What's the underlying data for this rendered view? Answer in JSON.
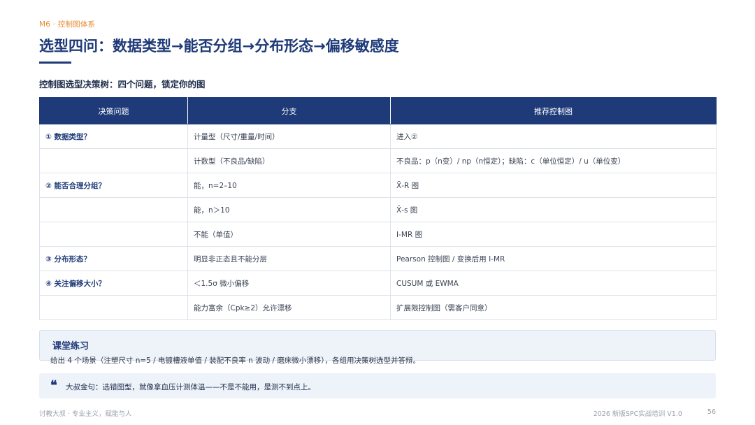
{
  "header": {
    "kicker": "M6 · 控制图体系",
    "title": "选型四问：数据类型→能否分组→分布形态→偏移敏感度",
    "subtitle": "控制图选型决策树：四个问题，锁定你的图"
  },
  "table": {
    "headers": [
      "决策问题",
      "分支",
      "推荐控制图"
    ],
    "rows": [
      {
        "question": "① 数据类型？",
        "branch": "计量型（尺寸/重量/时间）",
        "chart": "进入②"
      },
      {
        "question": "",
        "branch": "计数型（不良品/缺陷）",
        "chart": "不良品：p（n变）/ np（n恒定）；缺陷：c（单位恒定）/ u（单位变）"
      },
      {
        "question": "② 能否合理分组？",
        "branch": "能，n=2–10",
        "chart": "X̄-R 图"
      },
      {
        "question": "",
        "branch": "能，n＞10",
        "chart": "X̄-s 图"
      },
      {
        "question": "",
        "branch": "不能（单值）",
        "chart": "I-MR 图"
      },
      {
        "question": "③ 分布形态？",
        "branch": "明显非正态且不能分层",
        "chart": "Pearson 控制图 / 变换后用 I-MR"
      },
      {
        "question": "④ 关注偏移大小？",
        "branch": "＜1.5σ 微小偏移",
        "chart": "CUSUM 或 EWMA"
      },
      {
        "question": "",
        "branch": "能力富余（Cpk≥2）允许漂移",
        "chart": "扩展限控制图（需客户同意）"
      }
    ]
  },
  "exercise": {
    "title": "课堂练习",
    "body": "给出 4 个场景（注塑尺寸 n=5 / 电镀槽液单值 / 装配不良率 n 波动 / 磨床微小漂移），各组用决策树选型并答辩。"
  },
  "quote": {
    "icon": "quote-icon",
    "text": "大叔金句：选错图型，就像拿血压计测体温——不是不能用，是测不到点上。"
  },
  "footer": {
    "left": "讨教大叔 · 专业主义，赋能与人",
    "course": "2026 新版SPC实战培训 V1.0",
    "page": "56"
  }
}
